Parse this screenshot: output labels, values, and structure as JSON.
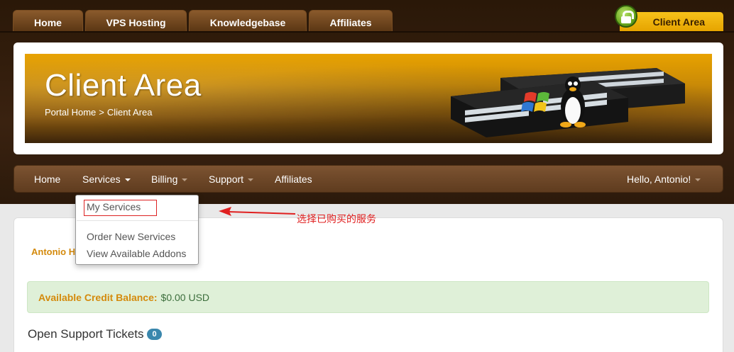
{
  "top_tabs": [
    "Home",
    "VPS Hosting",
    "Knowledgebase",
    "Affiliates"
  ],
  "client_area_tab": "Client Area",
  "banner": {
    "title": "Client Area",
    "breadcrumb": [
      "Portal Home",
      ">",
      "Client Area"
    ]
  },
  "nav": {
    "home": "Home",
    "services": "Services",
    "billing": "Billing",
    "support": "Support",
    "affiliates": "Affiliates",
    "user": "Hello, Antonio!"
  },
  "services_menu": {
    "my_services": "My Services",
    "order_new": "Order New Services",
    "addons": "View Available Addons"
  },
  "annotation": "选择已购买的服务",
  "main": {
    "user_name": "Antonio H",
    "credit_label": "Available Credit Balance:",
    "credit_value": "$0.00 USD",
    "tickets_label": "Open Support Tickets",
    "tickets_count": "0"
  },
  "colors": {
    "accent_gold": "#e6a400",
    "nav_brown": "#6b4527",
    "annotation_red": "#e02020",
    "badge_blue": "#3a87ad"
  }
}
